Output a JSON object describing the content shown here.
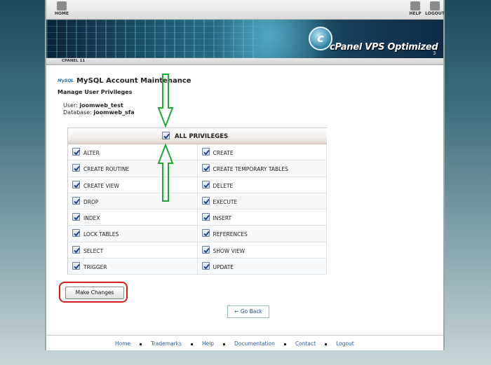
{
  "topbar": {
    "home_label": "HOME",
    "help_label": "HELP",
    "logout_label": "LOGOUT"
  },
  "banner": {
    "brand": "cPanel VPS Optimized",
    "brand_suffix": "3",
    "logo_letter": "c"
  },
  "subbar": {
    "version": "CPANEL 11"
  },
  "page": {
    "title": "MySQL Account Maintenance",
    "mysql_icon_text": "MySQL",
    "section_title": "Manage User Privileges",
    "user_label": "User:",
    "user_value": "joomweb_test",
    "db_label": "Database:",
    "db_value": "joomweb_sfa"
  },
  "privileges": {
    "all_label": "ALL PRIVILEGES",
    "all_checked": true,
    "rows": [
      [
        "ALTER",
        "CREATE"
      ],
      [
        "CREATE ROUTINE",
        "CREATE TEMPORARY TABLES"
      ],
      [
        "CREATE VIEW",
        "DELETE"
      ],
      [
        "DROP",
        "EXECUTE"
      ],
      [
        "INDEX",
        "INSERT"
      ],
      [
        "LOCK TABLES",
        "REFERENCES"
      ],
      [
        "SELECT",
        "SHOW VIEW"
      ],
      [
        "TRIGGER",
        "UPDATE"
      ]
    ]
  },
  "buttons": {
    "make_changes": "Make Changes",
    "go_back": "← Go Back"
  },
  "footer": {
    "links": [
      "Home",
      "Trademarks",
      "Help",
      "Documentation",
      "Contact",
      "Logout"
    ]
  },
  "colors": {
    "highlight_box": "#d21f1f",
    "annotation_arrow": "#22aa33",
    "link": "#2a5c9a"
  },
  "icons": {
    "home": "home-icon",
    "help": "help-icon",
    "logout": "logout-icon",
    "checkbox": "checkbox-checked-icon"
  }
}
